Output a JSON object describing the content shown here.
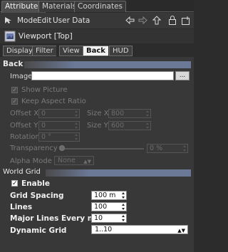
{
  "top_tabs": [
    "Attributes",
    "Materials",
    "Coordinates"
  ],
  "menu": {
    "mode": "Mode",
    "edit": "Edit",
    "user_data": "User Data"
  },
  "header": {
    "title": "Viewport [Top]"
  },
  "sub_tabs": [
    "Display",
    "Filter",
    "View",
    "Back",
    "HUD"
  ],
  "back": {
    "title": "Back",
    "image_label": "Image",
    "image_value": "",
    "browse_label": "...",
    "show_picture": "Show Picture",
    "keep_aspect": "Keep Aspect Ratio",
    "offset_x_label": "Offset X",
    "offset_x": "0",
    "size_x_label": "Size X",
    "size_x": "800",
    "offset_y_label": "Offset Y",
    "offset_y": "0",
    "size_y_label": "Size Y",
    "size_y": "600",
    "rotation_label": "Rotation",
    "rotation": "0 °",
    "transparency_label": "Transparency",
    "transparency": "0 %",
    "alpha_label": "Alpha Mode",
    "alpha_value": "None"
  },
  "grid": {
    "title": "World Grid",
    "enable": "Enable",
    "spacing_label": "Grid Spacing",
    "spacing": "100 m",
    "lines_label": "Lines",
    "lines": "100",
    "major_label": "Major Lines Every nth",
    "major": "10",
    "dynamic_label": "Dynamic Grid",
    "dynamic": "1..10"
  }
}
